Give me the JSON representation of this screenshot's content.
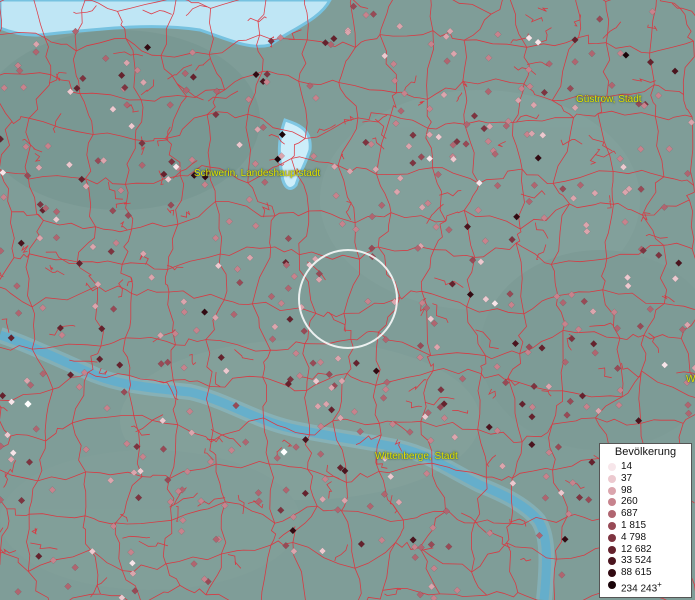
{
  "map": {
    "places": [
      {
        "id": "schwerin",
        "label": "Schwerin, Landeshauptstadt"
      },
      {
        "id": "guestrow",
        "label": "Güstrow, Stadt"
      },
      {
        "id": "wittenberge",
        "label": "Wittenberge, Stadt"
      }
    ],
    "edge_label_partial": "W",
    "colors": {
      "land": "#7f9d98",
      "water": "#4a9cbf",
      "boundary": "#e0303a",
      "label": "#e3e200"
    }
  },
  "legend": {
    "title": "Bevölkerung",
    "items": [
      {
        "label": "14",
        "color": "#f7e6ea"
      },
      {
        "label": "37",
        "color": "#ecc9cf"
      },
      {
        "label": "98",
        "color": "#dba5ad"
      },
      {
        "label": "260",
        "color": "#c7838d"
      },
      {
        "label": "687",
        "color": "#b06570"
      },
      {
        "label": "1 815",
        "color": "#984a56"
      },
      {
        "label": "4 798",
        "color": "#7e3440"
      },
      {
        "label": "12 682",
        "color": "#65222d"
      },
      {
        "label": "33 524",
        "color": "#4b141e"
      },
      {
        "label": "88 615",
        "color": "#320a12"
      },
      {
        "label": "234 243",
        "color": "#1a0409",
        "suffix": "+"
      }
    ]
  }
}
